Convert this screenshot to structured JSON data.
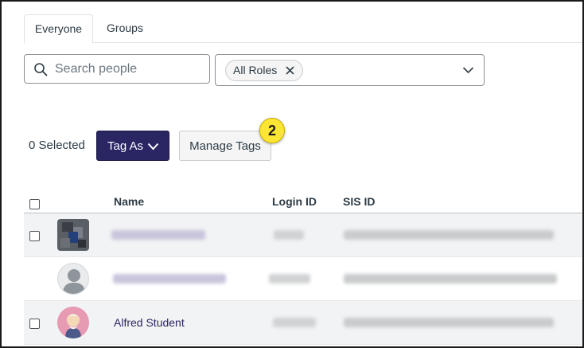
{
  "tabs": [
    {
      "label": "Everyone"
    },
    {
      "label": "Groups"
    }
  ],
  "search": {
    "placeholder": "Search people",
    "value": ""
  },
  "roles_filter": {
    "chip_label": "All Roles"
  },
  "actions": {
    "selected_label": "0 Selected",
    "tag_as_label": "Tag As",
    "manage_tags_label": "Manage Tags",
    "callout_number": "2"
  },
  "table": {
    "columns": [
      "Name",
      "Login ID",
      "SIS ID"
    ],
    "rows": [
      {
        "name": "",
        "login_id": "",
        "sis_id": "",
        "has_checkbox": true,
        "avatar": "blurred-photo"
      },
      {
        "name": "",
        "login_id": "",
        "sis_id": "",
        "has_checkbox": false,
        "avatar": "default-person"
      },
      {
        "name": "Alfred Student",
        "login_id": "",
        "sis_id": "",
        "has_checkbox": true,
        "avatar": "cartoon-student"
      }
    ]
  },
  "colors": {
    "primary_button": "#2a2563",
    "callout": "#fde533",
    "link": "#2a2563",
    "text": "#2d3b45"
  }
}
